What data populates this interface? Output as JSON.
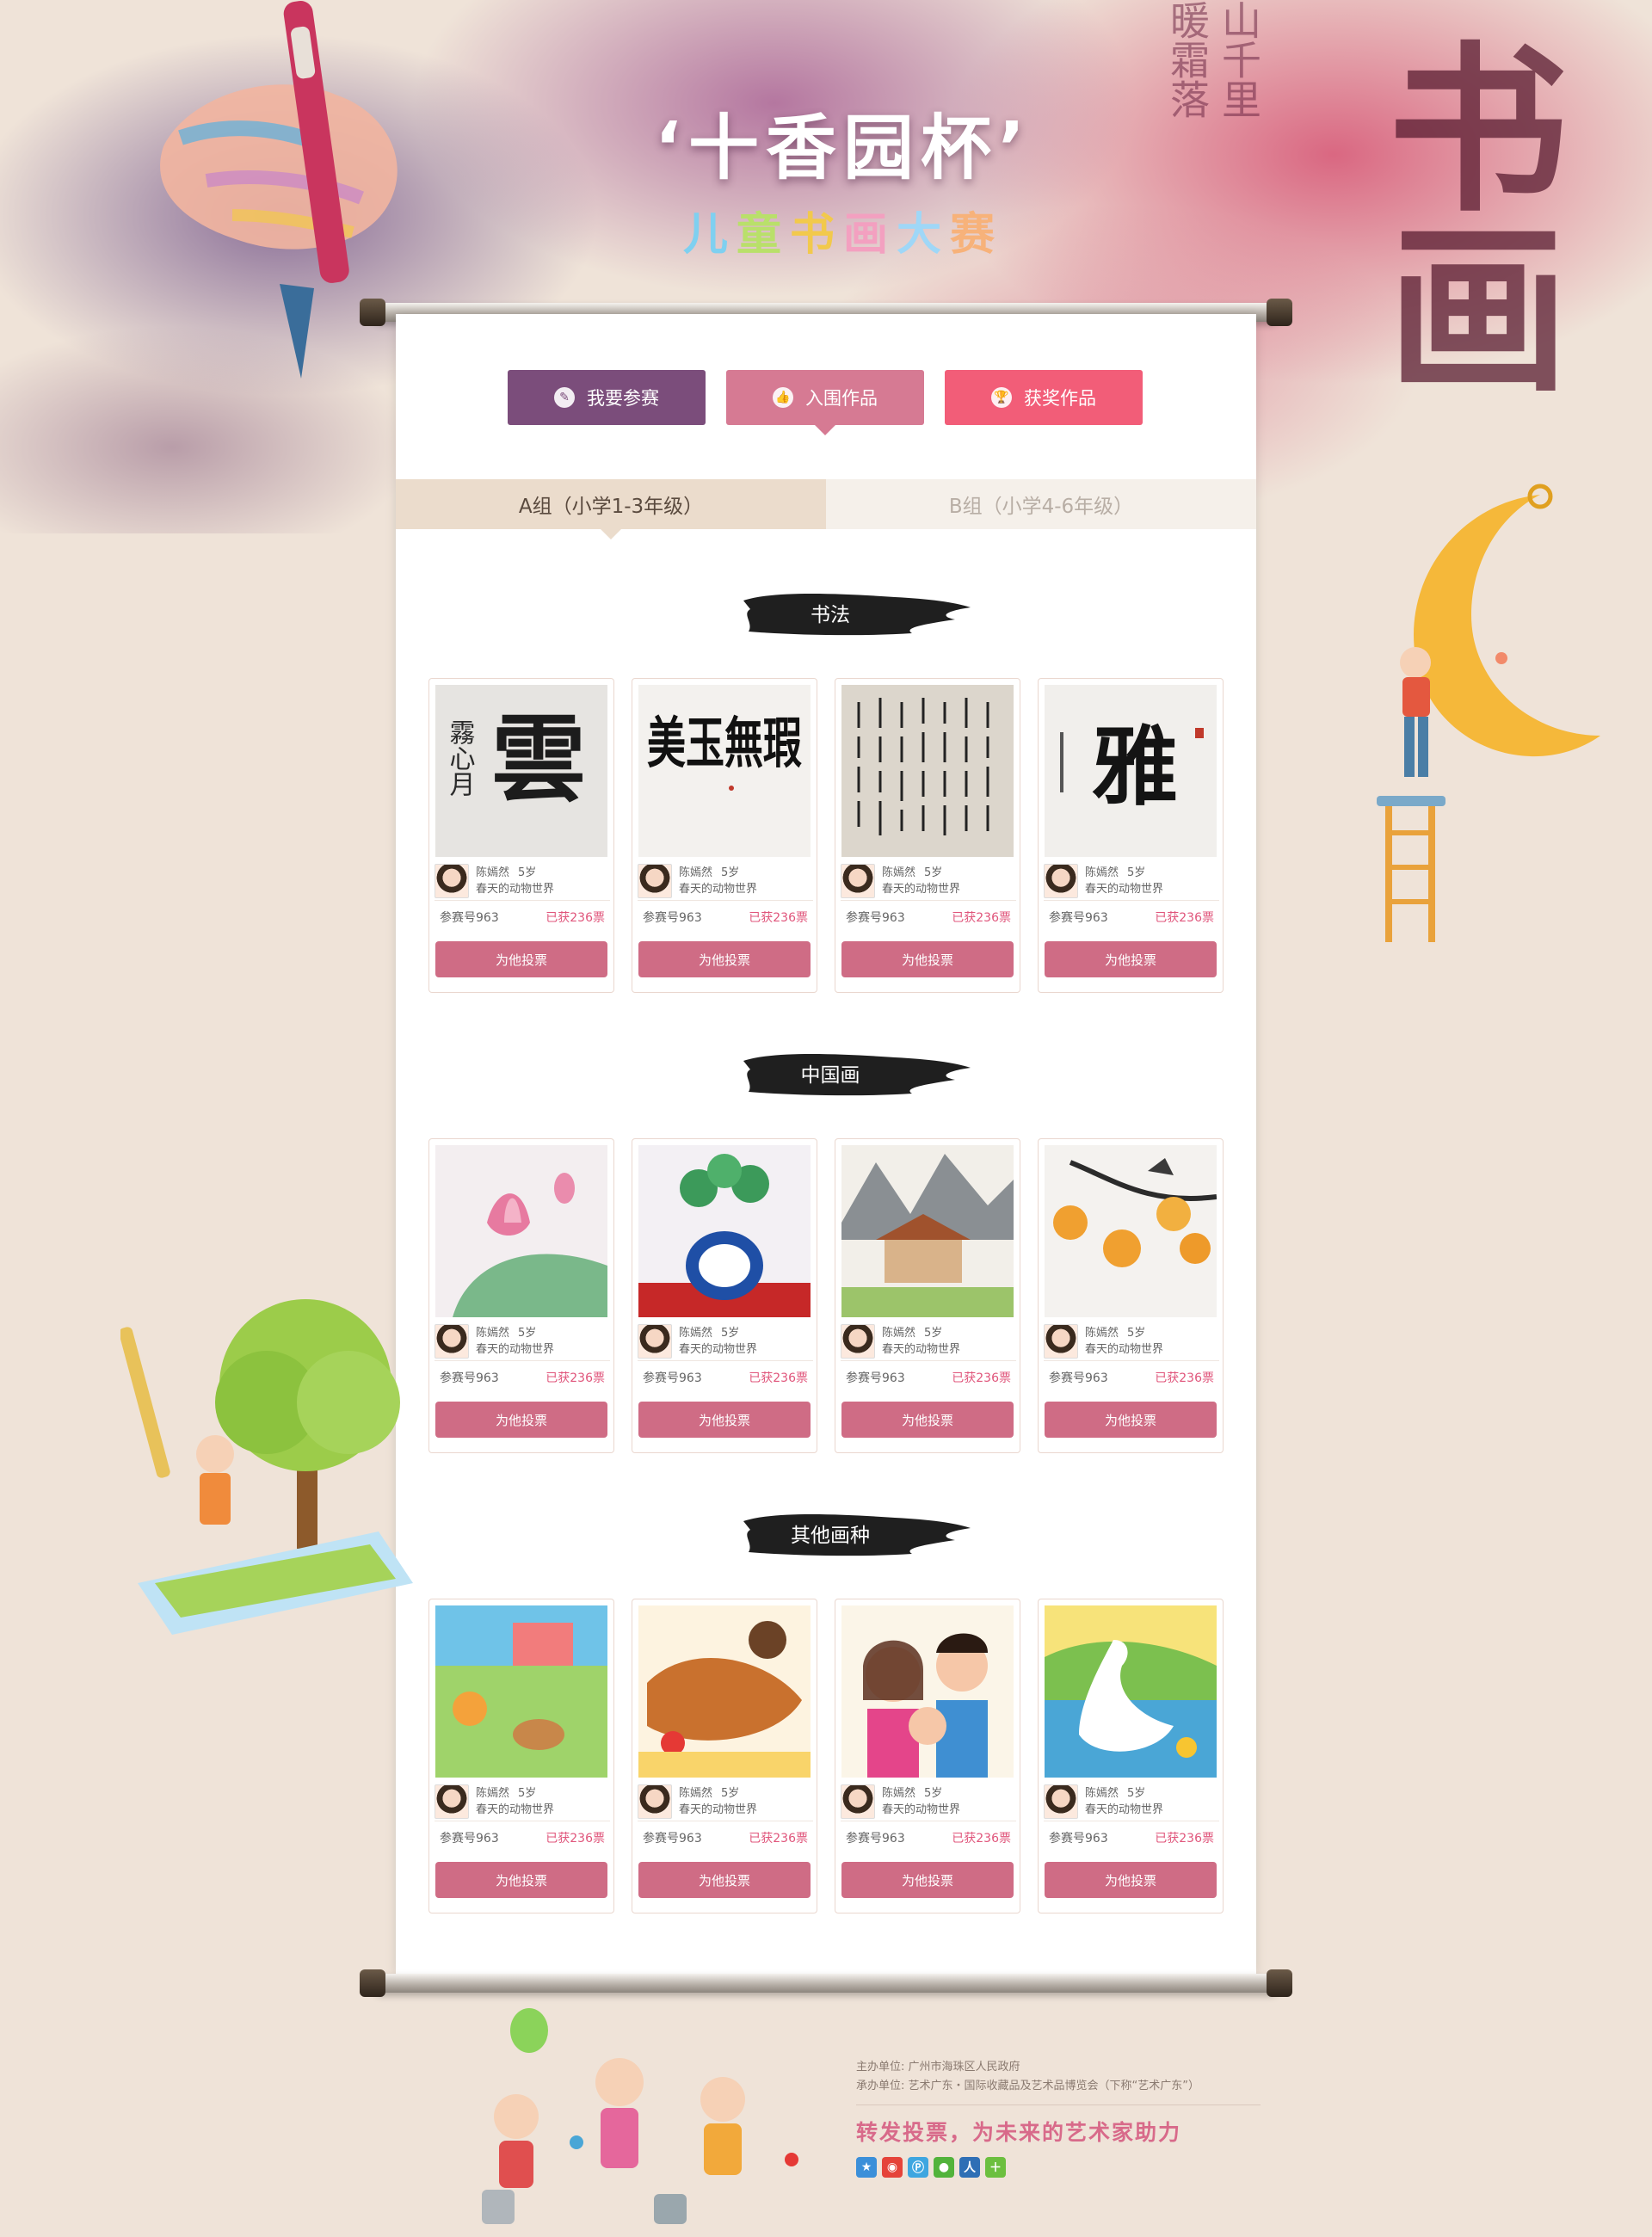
{
  "colors": {
    "join_btn": "#7b4d7b",
    "shortlist_btn": "#d67a93",
    "award_btn": "#f25d78",
    "vote_btn": "#cf6c85",
    "votes_text": "#e0557b"
  },
  "header": {
    "title_main": "‘十香园杯’",
    "title_sub": [
      "儿",
      "童",
      "书",
      "画",
      "大",
      "赛"
    ],
    "bg_calligraphy": "书画"
  },
  "nav": {
    "join": {
      "label": "我要参赛",
      "icon": "brush-icon"
    },
    "shortlist": {
      "label": "入围作品",
      "icon": "thumbs-up-icon"
    },
    "award": {
      "label": "获奖作品",
      "icon": "trophy-icon"
    }
  },
  "tabs": {
    "a": "A组（小学1-3年级）",
    "b": "B组（小学4-6年级）"
  },
  "sections": [
    {
      "title": "书法",
      "items": [
        {
          "author": "陈嫣然",
          "age": "5岁",
          "work": "春天的动物世界",
          "no": "参赛号963",
          "votes": "已获236票",
          "btn": "为他投票"
        },
        {
          "author": "陈嫣然",
          "age": "5岁",
          "work": "春天的动物世界",
          "no": "参赛号963",
          "votes": "已获236票",
          "btn": "为他投票"
        },
        {
          "author": "陈嫣然",
          "age": "5岁",
          "work": "春天的动物世界",
          "no": "参赛号963",
          "votes": "已获236票",
          "btn": "为他投票"
        },
        {
          "author": "陈嫣然",
          "age": "5岁",
          "work": "春天的动物世界",
          "no": "参赛号963",
          "votes": "已获236票",
          "btn": "为他投票"
        }
      ]
    },
    {
      "title": "中国画",
      "items": [
        {
          "author": "陈嫣然",
          "age": "5岁",
          "work": "春天的动物世界",
          "no": "参赛号963",
          "votes": "已获236票",
          "btn": "为他投票"
        },
        {
          "author": "陈嫣然",
          "age": "5岁",
          "work": "春天的动物世界",
          "no": "参赛号963",
          "votes": "已获236票",
          "btn": "为他投票"
        },
        {
          "author": "陈嫣然",
          "age": "5岁",
          "work": "春天的动物世界",
          "no": "参赛号963",
          "votes": "已获236票",
          "btn": "为他投票"
        },
        {
          "author": "陈嫣然",
          "age": "5岁",
          "work": "春天的动物世界",
          "no": "参赛号963",
          "votes": "已获236票",
          "btn": "为他投票"
        }
      ]
    },
    {
      "title": "其他画种",
      "items": [
        {
          "author": "陈嫣然",
          "age": "5岁",
          "work": "春天的动物世界",
          "no": "参赛号963",
          "votes": "已获236票",
          "btn": "为他投票"
        },
        {
          "author": "陈嫣然",
          "age": "5岁",
          "work": "春天的动物世界",
          "no": "参赛号963",
          "votes": "已获236票",
          "btn": "为他投票"
        },
        {
          "author": "陈嫣然",
          "age": "5岁",
          "work": "春天的动物世界",
          "no": "参赛号963",
          "votes": "已获236票",
          "btn": "为他投票"
        },
        {
          "author": "陈嫣然",
          "age": "5岁",
          "work": "春天的动物世界",
          "no": "参赛号963",
          "votes": "已获236票",
          "btn": "为他投票"
        }
      ]
    }
  ],
  "artwork_text": {
    "s0_a0_big": "雲",
    "s0_a0_small": "霧心月",
    "s0_a1": "美玉無瑕",
    "s0_a3": "雅"
  },
  "footer": {
    "host": "主办单位:   广州市海珠区人民政府",
    "organizer": "承办单位:   艺术广东・国际收藏品及艺术品博览会（下称“艺术广东”）",
    "slogan": "转发投票，为未来的艺术家助力",
    "share": [
      {
        "icon": "qzone-icon",
        "color": "#3b8fd9"
      },
      {
        "icon": "weibo-icon",
        "color": "#e5433a"
      },
      {
        "icon": "tencent-weibo-icon",
        "color": "#3ea6e0"
      },
      {
        "icon": "wechat-icon",
        "color": "#52b33b"
      },
      {
        "icon": "renren-icon",
        "color": "#2f6fb5"
      },
      {
        "icon": "more-icon",
        "color": "#6cbf3f"
      }
    ]
  }
}
